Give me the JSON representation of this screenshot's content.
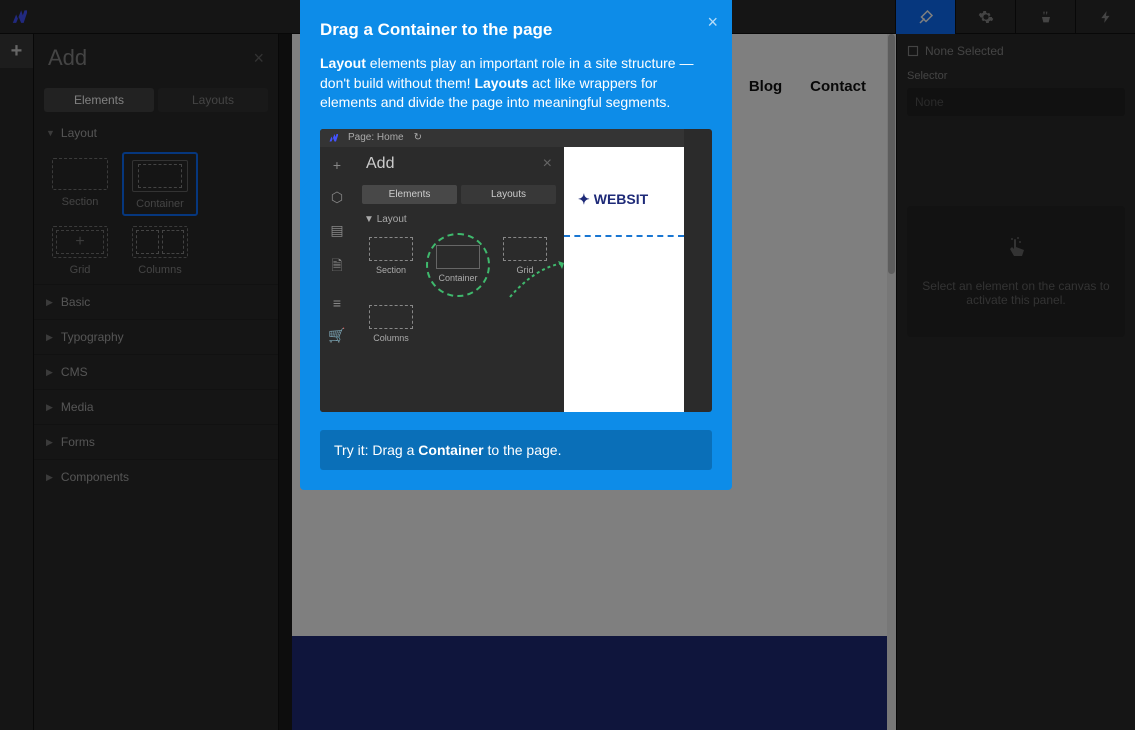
{
  "topbar": {
    "none_selected": "None Selected",
    "selector_label": "Selector",
    "selector_value": "None",
    "placeholder_text": "Select an element on the canvas to activate this panel."
  },
  "add_panel": {
    "title": "Add",
    "tab_elements": "Elements",
    "tab_layouts": "Layouts",
    "layout_label": "Layout",
    "items": {
      "section": "Section",
      "container": "Container",
      "grid": "Grid",
      "columns": "Columns"
    },
    "categories": [
      "Basic",
      "Typography",
      "CMS",
      "Media",
      "Forms",
      "Components"
    ]
  },
  "canvas": {
    "nav": [
      "Blog",
      "Contact"
    ]
  },
  "popup": {
    "title": "Drag a Container to the page",
    "body_prefix_bold": "Layout",
    "body_prefix_text": " elements play an important role in a site structure — don't build without them! ",
    "body_mid_bold": "Layouts",
    "body_suffix": " act like wrappers for elements and divide the page into meaningful segments.",
    "try_prefix": "Try it: Drag a ",
    "try_bold": "Container",
    "try_suffix": " to the page.",
    "mini": {
      "page_label": "Page:",
      "page_name": "Home",
      "add": "Add",
      "elements": "Elements",
      "layouts": "Layouts",
      "layout": "Layout",
      "section": "Section",
      "container": "Container",
      "grid": "Grid",
      "columns": "Columns",
      "brand": "WEBSIT"
    }
  }
}
